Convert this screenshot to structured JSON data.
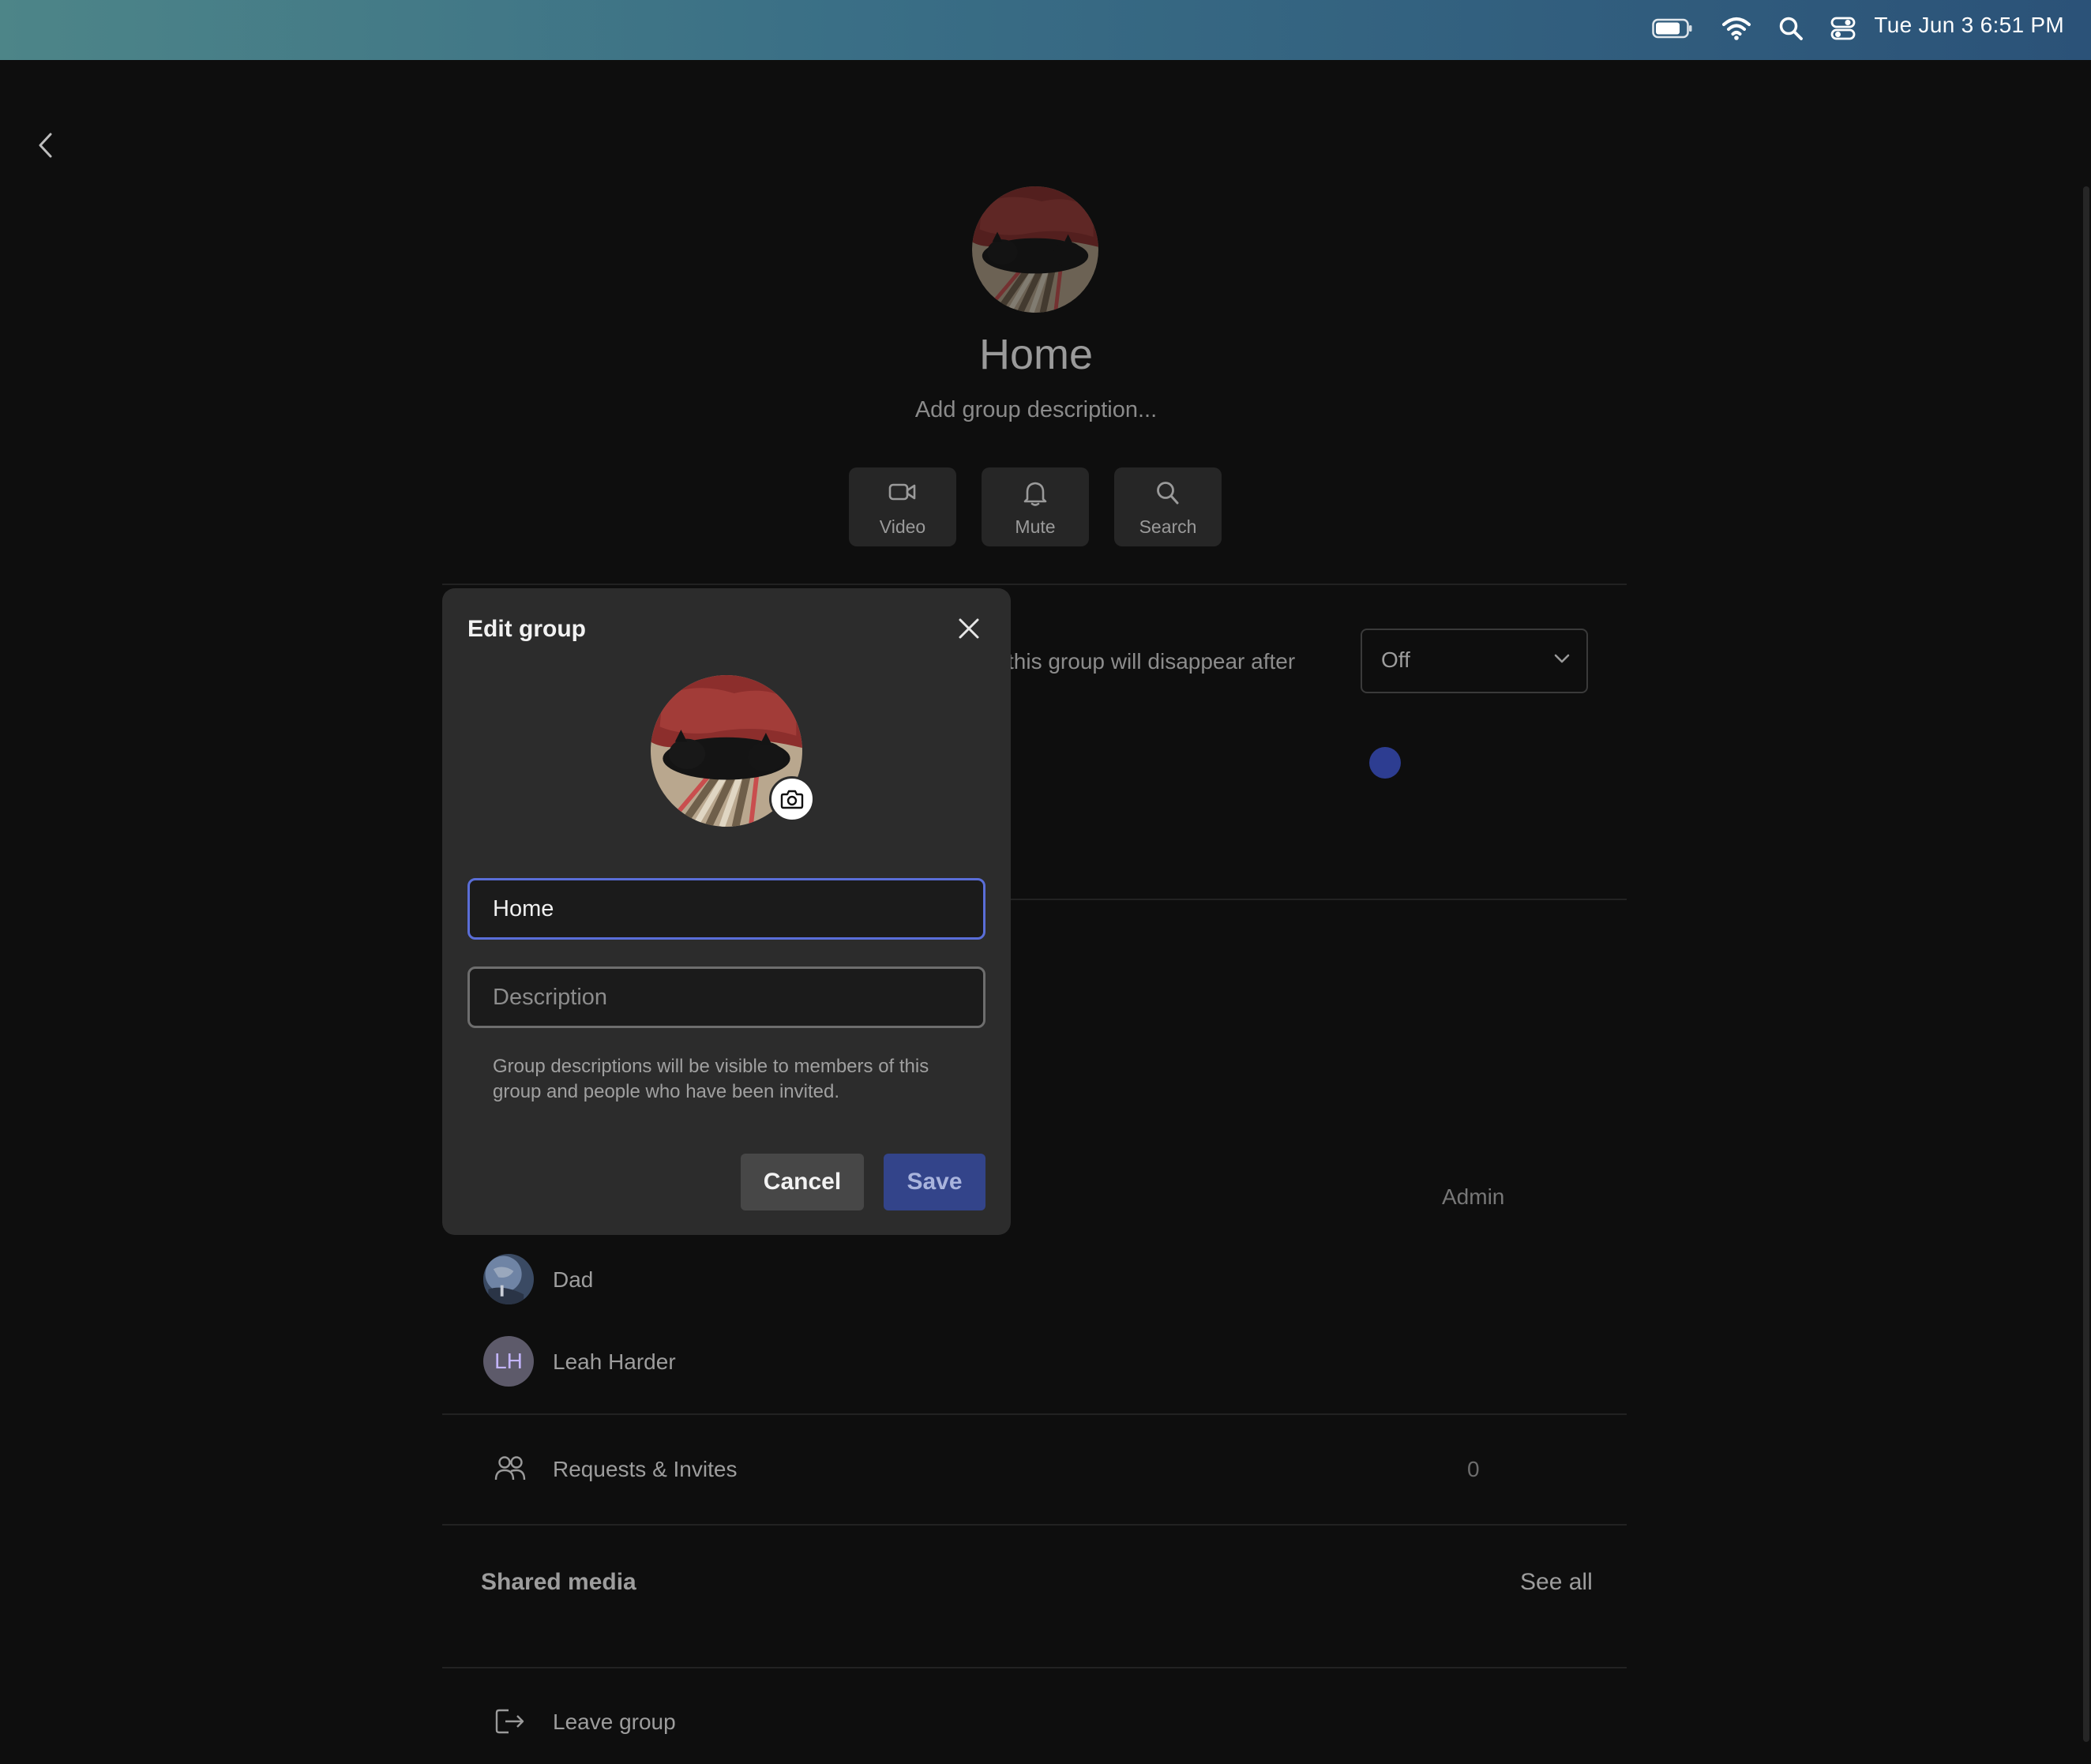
{
  "menubar": {
    "icons": [
      "battery-icon",
      "wifi-icon",
      "spotlight-search-icon",
      "control-center-icon"
    ],
    "clock": "Tue Jun 3  6:51 PM"
  },
  "nav": {
    "back_icon": "chevron-left-icon"
  },
  "group": {
    "title": "Home",
    "description_placeholder": "Add group description..."
  },
  "actions": [
    {
      "label": "Video",
      "icon": "video-camera-icon"
    },
    {
      "label": "Mute",
      "icon": "bell-icon"
    },
    {
      "label": "Search",
      "icon": "search-icon"
    }
  ],
  "disappearing": {
    "text_visible": "this group will disappear after",
    "timer_value": "Off"
  },
  "members": {
    "admin_label": "Admin",
    "list": [
      {
        "name": "Dad",
        "avatar": "photo"
      },
      {
        "name": "Leah Harder",
        "initials": "LH"
      }
    ]
  },
  "requests": {
    "label": "Requests & Invites",
    "count": "0",
    "icon": "people-icon"
  },
  "shared_media": {
    "label": "Shared media",
    "see_all": "See all"
  },
  "leave": {
    "label": "Leave group",
    "icon": "leave-icon"
  },
  "modal": {
    "title": "Edit group",
    "name_value": "Home",
    "description_placeholder": "Description",
    "helper": "Group descriptions will be visible to members of this group and people who have been invited.",
    "cancel": "Cancel",
    "save": "Save"
  },
  "colors": {
    "accent_focus": "#5a6ed8",
    "save_button": "#33448a",
    "blue_dot": "#2d3d91"
  }
}
